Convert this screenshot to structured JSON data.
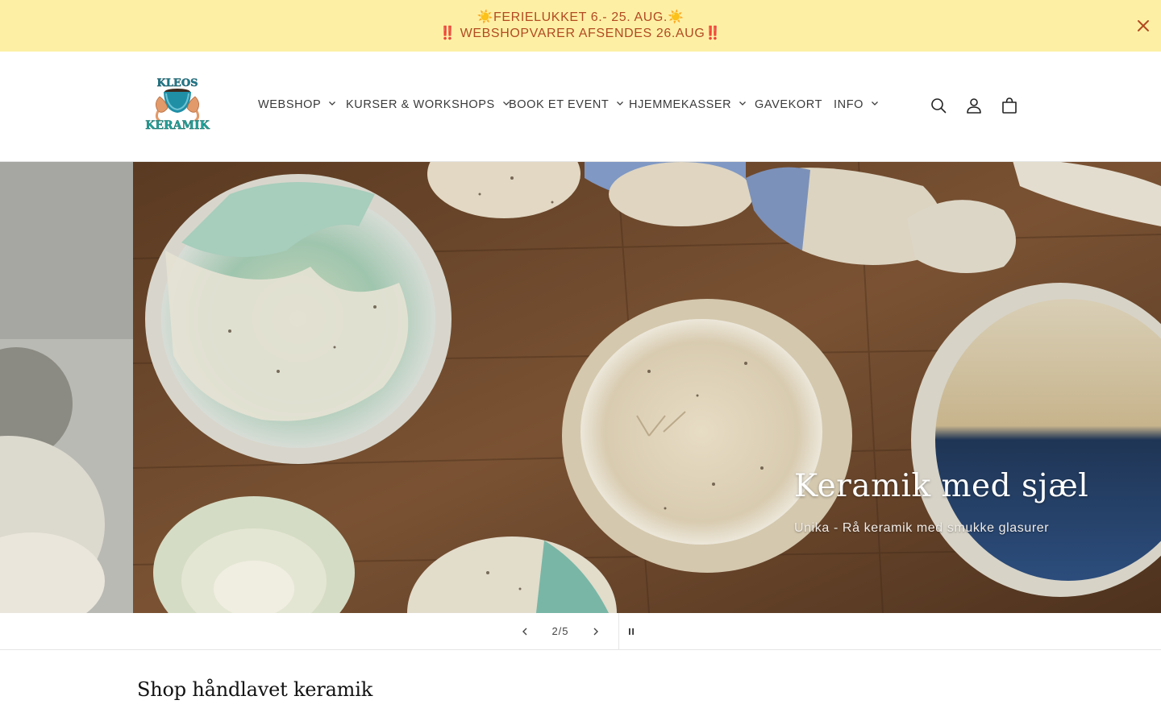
{
  "announcement": {
    "line1": "☀️FERIELUKKET 6.- 25. AUG.☀️",
    "line2": "‼️ WEBSHOPVARER AFSENDES 26.AUG‼️",
    "close_icon": "close-icon",
    "text_color": "#b24a21",
    "background": "#fdf0a5"
  },
  "header": {
    "logo": {
      "top_text": "KLEOS",
      "bottom_text": "KERAMIK"
    },
    "nav": {
      "webshop": "WEBSHOP",
      "kurser": "KURSER & WORKSHOPS",
      "book": "BOOK ET EVENT",
      "hjemmekasser": "HJEMMEKASSER",
      "gavekort": "GAVEKORT",
      "info": "INFO"
    },
    "icons": [
      "search-icon",
      "account-icon",
      "cart-icon"
    ]
  },
  "hero": {
    "heading": "Keramik med sjæl",
    "subheading": "Unika - Rå keramik med smukke glasurer"
  },
  "slider": {
    "counter": "2/5",
    "icons": [
      "chevron-left-icon",
      "chevron-right-icon",
      "pause-icon"
    ]
  },
  "section": {
    "title": "Shop håndlavet keramik"
  }
}
